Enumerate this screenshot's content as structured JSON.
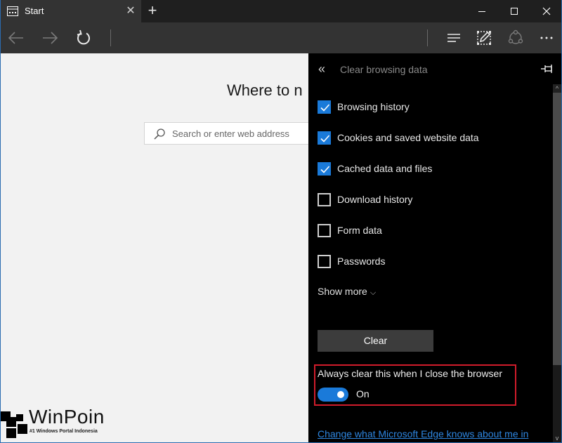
{
  "window": {
    "tab_title": "Start",
    "tab_close_glyph": "✕",
    "new_tab_glyph": "+",
    "controls": {
      "minimize_glyph": "—",
      "maximize_glyph": "☐",
      "close_glyph": "✕"
    },
    "border_color": "#2b6cb0"
  },
  "toolbar": {
    "buttons": [
      "back",
      "forward",
      "refresh",
      "hub",
      "web-note",
      "share",
      "more"
    ],
    "more_glyph": "···"
  },
  "page": {
    "headline": "Where to n",
    "search_placeholder": "Search or enter web address"
  },
  "hub": {
    "back_glyph": "«",
    "title": "Clear browsing data",
    "options": [
      {
        "label": "Browsing history",
        "checked": true
      },
      {
        "label": "Cookies and saved website data",
        "checked": true
      },
      {
        "label": "Cached data and files",
        "checked": true
      },
      {
        "label": "Download history",
        "checked": false
      },
      {
        "label": "Form data",
        "checked": false
      },
      {
        "label": "Passwords",
        "checked": false
      }
    ],
    "show_more_label": "Show more",
    "show_more_chevron": "⌵",
    "clear_button_label": "Clear",
    "always_clear_label": "Always clear this when I close the browser",
    "always_clear_on": true,
    "toggle_state_label": "On",
    "privacy_link": "Change what Microsoft Edge knows about me in",
    "accent_color": "#1a7ad9",
    "highlight_color": "#d01c2b",
    "scroll_up_glyph": "^",
    "scroll_down_glyph": "v"
  },
  "watermark": {
    "brand": "WinPoin",
    "tagline": "#1 Windows Portal Indonesia"
  }
}
